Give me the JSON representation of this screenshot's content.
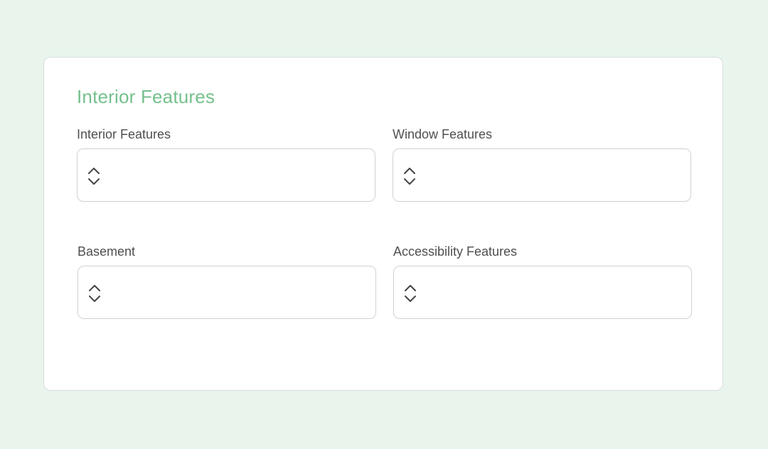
{
  "section": {
    "title": "Interior Features"
  },
  "fields": [
    {
      "label": "Interior Features",
      "value": "",
      "icon": "updown-chevron-icon"
    },
    {
      "label": "Window Features",
      "value": "",
      "icon": "updown-chevron-icon"
    },
    {
      "label": "Basement",
      "value": "",
      "icon": "updown-chevron-icon"
    },
    {
      "label": "Accessibility Features",
      "value": "",
      "icon": "updown-chevron-icon"
    }
  ],
  "colors": {
    "background": "#e9f5ec",
    "title": "#74c08c",
    "label": "#4f4f4f",
    "border": "#cfd2d1"
  }
}
